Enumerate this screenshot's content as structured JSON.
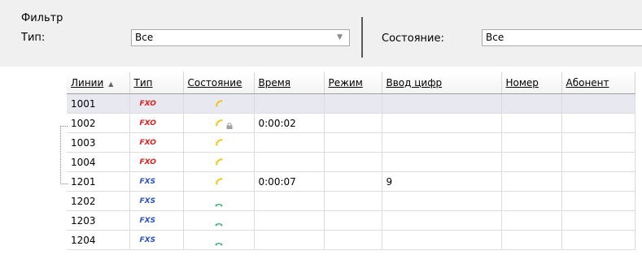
{
  "filter": {
    "title": "Фильтр",
    "type_label": "Тип:",
    "type_value": "Все",
    "state_label": "Состояние:",
    "state_value": "Все"
  },
  "table": {
    "columns": [
      "Линии",
      "Тип",
      "Состояние",
      "Время",
      "Режим",
      "Ввод цифр",
      "Номер",
      "Абонент"
    ],
    "sorted_column": "Линии",
    "sort_direction": "ascending",
    "selected_row": "1001",
    "rows": [
      {
        "line": "1001",
        "type": "FXO",
        "state_icon": "phone-yellow-icon",
        "locked": false,
        "time": "",
        "mode": "",
        "digits": "",
        "number": "",
        "subscriber": ""
      },
      {
        "line": "1002",
        "type": "FXO",
        "state_icon": "phone-yellow-icon",
        "locked": true,
        "time": "0:00:02",
        "mode": "",
        "digits": "",
        "number": "",
        "subscriber": ""
      },
      {
        "line": "1003",
        "type": "FXO",
        "state_icon": "phone-yellow-icon",
        "locked": false,
        "time": "",
        "mode": "",
        "digits": "",
        "number": "",
        "subscriber": ""
      },
      {
        "line": "1004",
        "type": "FXO",
        "state_icon": "phone-yellow-icon",
        "locked": false,
        "time": "",
        "mode": "",
        "digits": "",
        "number": "",
        "subscriber": ""
      },
      {
        "line": "1201",
        "type": "FXS",
        "state_icon": "phone-yellow-icon",
        "locked": false,
        "time": "0:00:07",
        "mode": "",
        "digits": "9",
        "number": "",
        "subscriber": ""
      },
      {
        "line": "1202",
        "type": "FXS",
        "state_icon": "phone-green-icon",
        "locked": false,
        "time": "",
        "mode": "",
        "digits": "",
        "number": "",
        "subscriber": ""
      },
      {
        "line": "1203",
        "type": "FXS",
        "state_icon": "phone-green-icon",
        "locked": false,
        "time": "",
        "mode": "",
        "digits": "",
        "number": "",
        "subscriber": ""
      },
      {
        "line": "1204",
        "type": "FXS",
        "state_icon": "phone-green-icon",
        "locked": false,
        "time": "",
        "mode": "",
        "digits": "",
        "number": "",
        "subscriber": ""
      }
    ]
  },
  "colors": {
    "fxo": "#e02020",
    "fxs": "#2a52c8",
    "phone_yellow": "#f2c200",
    "phone_green": "#3cb371",
    "lock": "#a0a0a0",
    "selected_row": "#e8e8f0"
  }
}
